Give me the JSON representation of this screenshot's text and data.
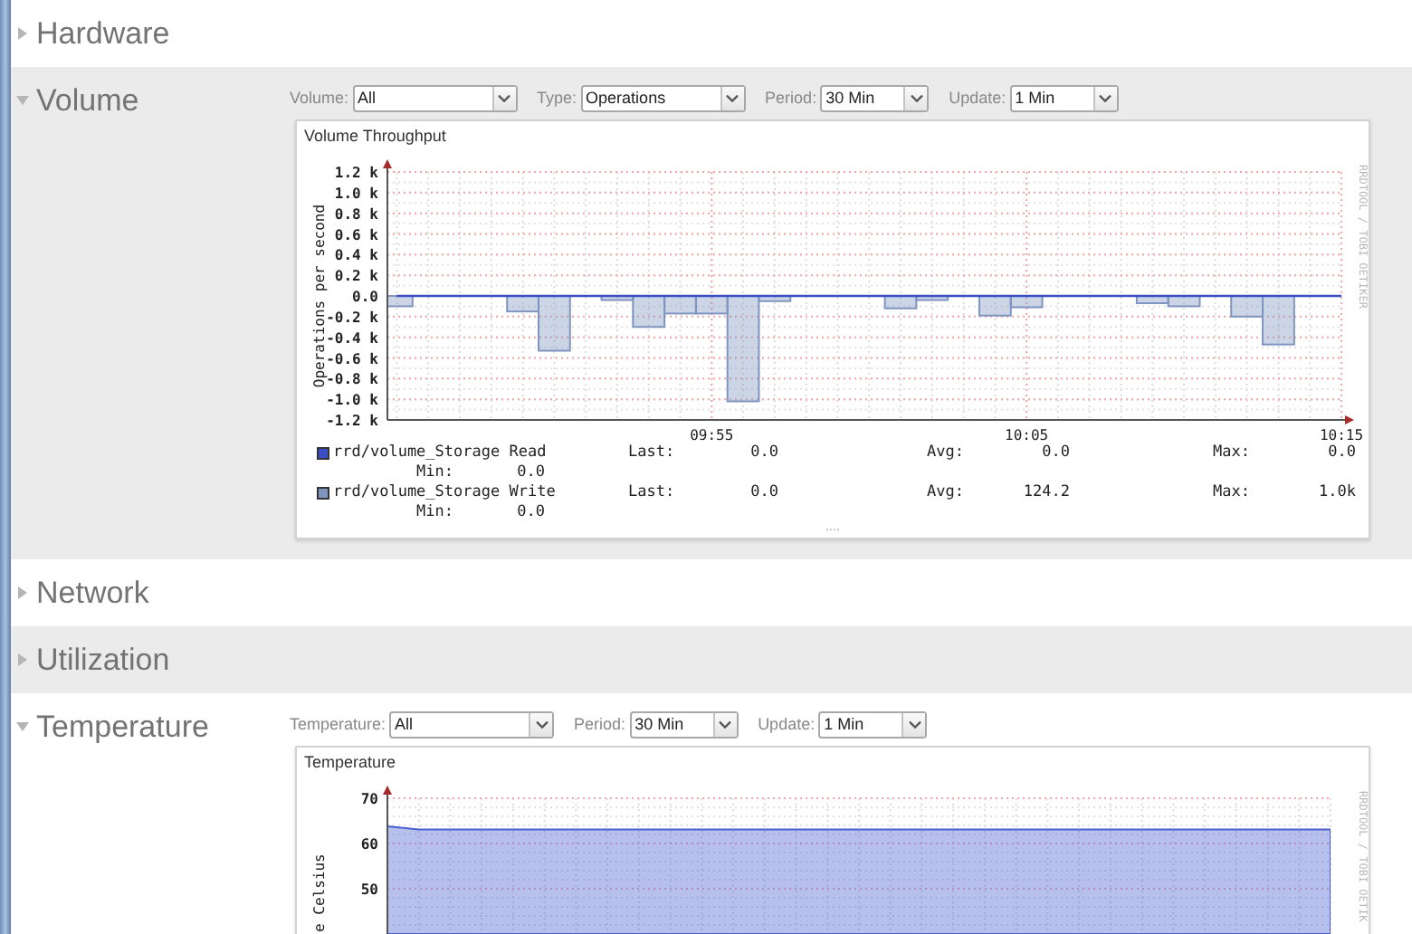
{
  "sections": [
    {
      "title": "Hardware",
      "expanded": false
    },
    {
      "title": "Volume",
      "expanded": true,
      "filters": [
        {
          "label": "Volume:",
          "value": "All"
        },
        {
          "label": "Type:",
          "value": "Operations"
        },
        {
          "label": "Period:",
          "value": "30 Min"
        },
        {
          "label": "Update:",
          "value": "1 Min"
        }
      ],
      "graph": {
        "title": "Volume Throughput",
        "credit": "RRDTOOL / TOBI OETIKER",
        "chart_data": {
          "type": "bar",
          "grid": true,
          "ylabel": "Operations per second",
          "ylim": [
            -1200,
            1200
          ],
          "categories": [
            null,
            null,
            null,
            null,
            null,
            null,
            null,
            null,
            null,
            null,
            "09:55",
            null,
            null,
            null,
            null,
            null,
            null,
            null,
            null,
            null,
            "10:05",
            null,
            null,
            null,
            null,
            null,
            null,
            null,
            null,
            null,
            "10:15"
          ],
          "yticks": [
            {
              "value": 1200,
              "label": "1.2 k"
            },
            {
              "value": 1000,
              "label": "1.0 k"
            },
            {
              "value": 800,
              "label": "0.8 k"
            },
            {
              "value": 600,
              "label": "0.6 k"
            },
            {
              "value": 400,
              "label": "0.4 k"
            },
            {
              "value": 200,
              "label": "0.2 k"
            },
            {
              "value": 0,
              "label": "0.0"
            },
            {
              "value": -200,
              "label": "-0.2 k"
            },
            {
              "value": -400,
              "label": "-0.4 k"
            },
            {
              "value": -600,
              "label": "-0.6 k"
            },
            {
              "value": -800,
              "label": "-0.8 k"
            },
            {
              "value": -1000,
              "label": "-1.0 k"
            },
            {
              "value": -1200,
              "label": "-1.2 k"
            }
          ],
          "series": [
            {
              "name": "rrd/volume_Storage Read",
              "type": "line",
              "color": "#3b4fc4",
              "values": [
                0,
                0,
                0,
                0,
                0,
                0,
                0,
                0,
                0,
                0,
                0,
                0,
                0,
                0,
                0,
                0,
                0,
                0,
                0,
                0,
                0,
                0,
                0,
                0,
                0,
                0,
                0,
                0,
                0,
                0,
                0
              ]
            },
            {
              "name": "rrd/volume_Storage Write",
              "color": "#7f95c0",
              "values": [
                -100,
                0,
                0,
                0,
                -150,
                -530,
                0,
                -40,
                -300,
                -170,
                -170,
                -1020,
                -50,
                0,
                0,
                0,
                -120,
                -40,
                0,
                -190,
                -110,
                0,
                0,
                0,
                -70,
                -100,
                0,
                -200,
                -470,
                null,
                null
              ]
            }
          ]
        },
        "legend": [
          {
            "stats": [
              {
                "label": "Last:",
                "value": "0.0"
              },
              {
                "label": "Avg:",
                "value": "0.0"
              },
              {
                "label": "Max:",
                "value": "0.0"
              },
              {
                "label": "Min:",
                "value": "0.0"
              }
            ]
          },
          {
            "stats": [
              {
                "label": "Last:",
                "value": "0.0"
              },
              {
                "label": "Avg:",
                "value": "124.2"
              },
              {
                "label": "Max:",
                "value": "1.0k"
              },
              {
                "label": "Min:",
                "value": "0.0"
              }
            ]
          }
        ],
        "more": "...."
      }
    },
    {
      "title": "Network",
      "expanded": false
    },
    {
      "title": "Utilization",
      "expanded": false
    },
    {
      "title": "Temperature",
      "expanded": true,
      "filters": [
        {
          "label": "Temperature:",
          "value": "All"
        },
        {
          "label": "Period:",
          "value": "30 Min"
        },
        {
          "label": "Update:",
          "value": "1 Min"
        }
      ],
      "graph": {
        "title": "Temperature",
        "credit": "RRDTOOL / TOBI OETIK",
        "chart_data": {
          "type": "area",
          "grid": true,
          "ylabel": "e Celsius",
          "ylim": [
            40,
            70
          ],
          "categories": [
            null,
            null,
            null,
            null,
            null,
            null,
            null,
            null,
            null,
            null,
            null,
            null,
            null,
            null,
            null,
            null,
            null,
            null,
            null,
            null,
            null,
            null,
            null,
            null,
            null,
            null,
            null,
            null,
            null,
            null,
            null
          ],
          "yticks": [
            70,
            60,
            50
          ],
          "series": [
            {
              "color": "#4a5fd0",
              "values": [
                63.8,
                63.1,
                63.1,
                63.1,
                63.1,
                63.1,
                63.1,
                63.1,
                63.1,
                63.1,
                63.1,
                63.1,
                63.1,
                63.1,
                63.1,
                63.1,
                63.1,
                63.1,
                63.1,
                63.1,
                63.1,
                63.1,
                63.1,
                63.1,
                63.1,
                63.1,
                63.1,
                63.1,
                63.1,
                63.1,
                63.1
              ]
            }
          ]
        }
      }
    }
  ]
}
